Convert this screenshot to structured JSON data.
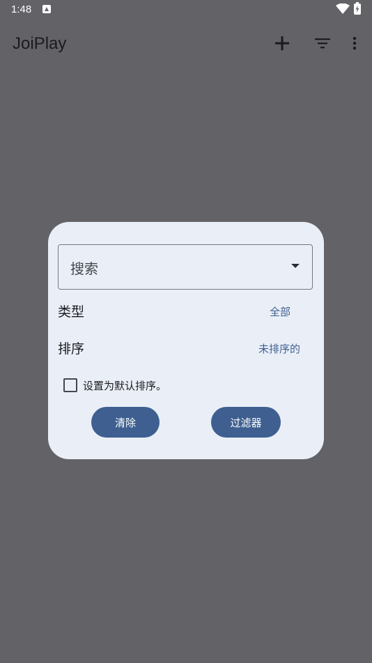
{
  "status_bar": {
    "time": "1:48",
    "icons": [
      "app-notification-icon",
      "wifi-icon",
      "battery-charging-icon"
    ]
  },
  "app_bar": {
    "title": "JoiPlay",
    "actions": [
      "add-icon",
      "filter-icon",
      "more-vert-icon"
    ]
  },
  "dialog": {
    "search": {
      "placeholder": "搜索"
    },
    "type": {
      "label": "类型",
      "value": "全部"
    },
    "sort": {
      "label": "排序",
      "value": "未排序的"
    },
    "default_sort_checkbox": {
      "label": "设置为默认排序。",
      "checked": false
    },
    "buttons": {
      "clear": "清除",
      "filter": "过滤器"
    }
  },
  "colors": {
    "scrim": "#636367",
    "dialog_bg": "#eaeff7",
    "accent": "#3e5f90"
  }
}
